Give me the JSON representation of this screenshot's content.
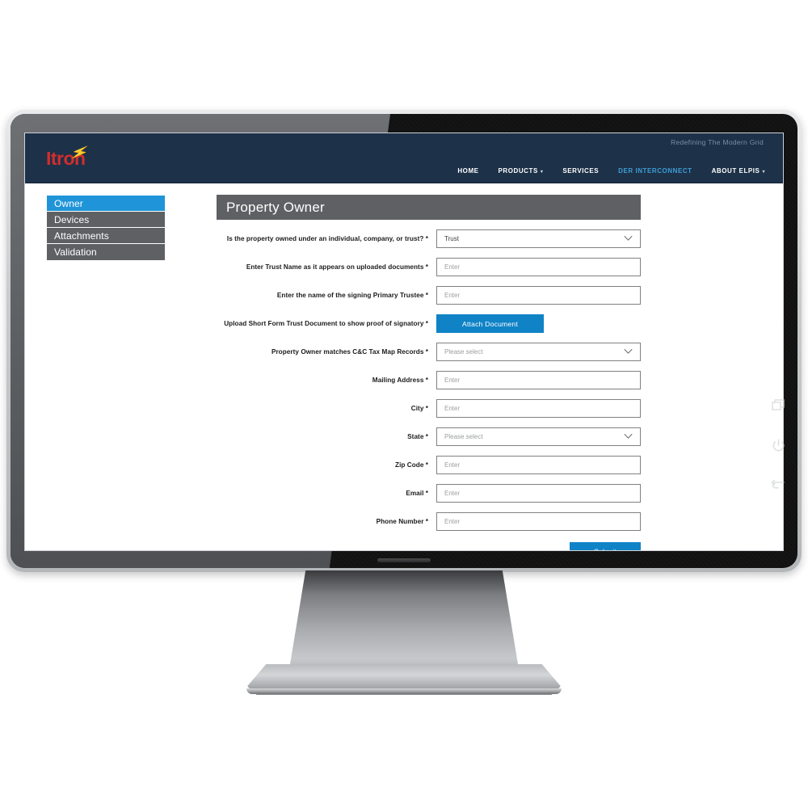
{
  "site": {
    "tagline": "Redefining The Modern Grid",
    "logo_text": "Itron",
    "logo_color": "#d22d2d",
    "logo_accent_color": "#f2c21a",
    "header_bg": "#1d3149",
    "accent_blue": "#1f94d8",
    "button_blue": "#1083c6",
    "nav": [
      {
        "label": "HOME",
        "active": false,
        "has_caret": false
      },
      {
        "label": "PRODUCTS",
        "active": false,
        "has_caret": true
      },
      {
        "label": "SERVICES",
        "active": false,
        "has_caret": false
      },
      {
        "label": "DER INTERCONNECT",
        "active": true,
        "has_caret": false
      },
      {
        "label": "ABOUT ELPIS",
        "active": false,
        "has_caret": true
      }
    ]
  },
  "sidebar": {
    "items": [
      {
        "label": "Owner",
        "active": true
      },
      {
        "label": "Devices",
        "active": false
      },
      {
        "label": "Attachments",
        "active": false
      },
      {
        "label": "Validation",
        "active": false
      }
    ]
  },
  "panel": {
    "title": "Property Owner",
    "fields": [
      {
        "label": "Is the property owned under an individual, company, or trust? *",
        "type": "select",
        "value": "Trust",
        "is_placeholder": false
      },
      {
        "label": "Enter Trust Name as it appears on uploaded documents *",
        "type": "input",
        "value": "",
        "placeholder": "Enter"
      },
      {
        "label": "Enter the name of the signing Primary Trustee *",
        "type": "input",
        "value": "",
        "placeholder": "Enter"
      },
      {
        "label": "Upload Short Form Trust Document to show proof of signatory *",
        "type": "button",
        "value": "Attach Document"
      },
      {
        "label": "Property Owner matches C&C Tax Map Records *",
        "type": "select",
        "value": "Please select",
        "is_placeholder": true
      },
      {
        "label": "Mailing Address *",
        "type": "input",
        "value": "",
        "placeholder": "Enter"
      },
      {
        "label": "City *",
        "type": "input",
        "value": "",
        "placeholder": "Enter"
      },
      {
        "label": "State *",
        "type": "select",
        "value": "Please select",
        "is_placeholder": true
      },
      {
        "label": "Zip Code *",
        "type": "input",
        "value": "",
        "placeholder": "Enter"
      },
      {
        "label": "Email *",
        "type": "input",
        "value": "",
        "placeholder": "Enter"
      },
      {
        "label": "Phone Number *",
        "type": "input",
        "value": "",
        "placeholder": "Enter"
      }
    ],
    "submit_label": "Submit"
  },
  "monitor": {
    "bezel_controls": [
      {
        "icon": "windows-switch-icon"
      },
      {
        "icon": "power-icon"
      },
      {
        "icon": "back-arrow-icon"
      }
    ]
  }
}
